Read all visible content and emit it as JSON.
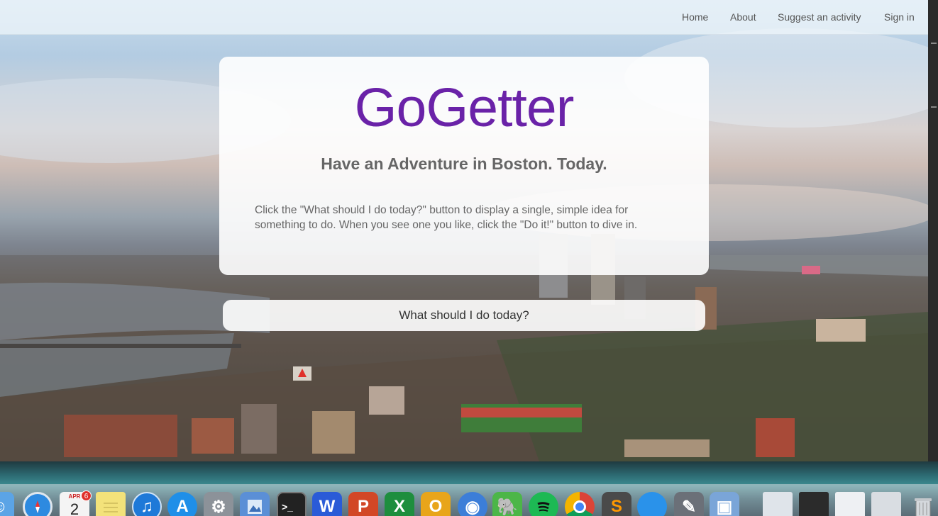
{
  "navbar": {
    "links": [
      {
        "label": "Home"
      },
      {
        "label": "About"
      },
      {
        "label": "Suggest an activity"
      },
      {
        "label": "Sign in"
      }
    ]
  },
  "hero": {
    "title": "GoGetter",
    "subtitle": "Have an Adventure in Boston. Today.",
    "description": "Click the \"What should I do today?\" button to display a single, simple idea for something to do. When you see one you like, click the \"Do it!\" button to dive in."
  },
  "action_button": {
    "label": "What should I do today?"
  },
  "colors": {
    "title_purple": "#6a22a8",
    "text_gray": "#666666"
  },
  "dock": {
    "calendar": {
      "month": "APR",
      "day": "2",
      "badge": "6"
    },
    "items": [
      "finder-icon",
      "safari-icon",
      "calendar-icon",
      "notes-icon",
      "itunes-icon",
      "app-store-icon",
      "system-preferences-icon",
      "preview-icon",
      "terminal-icon",
      "word-icon",
      "powerpoint-icon",
      "excel-icon",
      "outlook-icon",
      "network-icon",
      "evernote-icon",
      "spotify-icon",
      "chrome-icon",
      "sublime-text-icon",
      "messages-icon",
      "utilities-icon",
      "photo-icon",
      "window-thumbnail-icon",
      "trash-icon"
    ]
  }
}
